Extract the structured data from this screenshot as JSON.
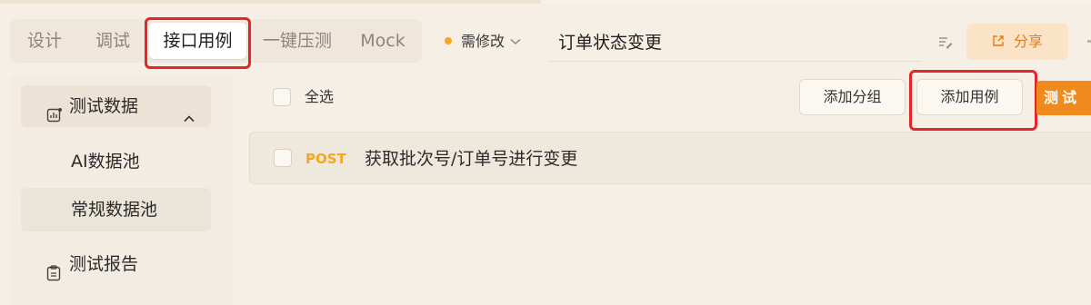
{
  "tabs": [
    {
      "label": "设计",
      "active": false
    },
    {
      "label": "调试",
      "active": false
    },
    {
      "label": "接口用例",
      "active": true
    },
    {
      "label": "一键压测",
      "active": false
    },
    {
      "label": "Mock",
      "active": false
    }
  ],
  "header": {
    "status": {
      "label": "需修改",
      "dot_color": "#f5a623",
      "icon": "chevron-down-icon"
    },
    "title_value": "订单状态变更",
    "edit_icon": "edit-icon",
    "share": {
      "label": "分享",
      "icon": "share-icon"
    }
  },
  "sidebar": {
    "section": {
      "label": "测试数据",
      "icon": "chart-icon",
      "expanded": true
    },
    "items": [
      {
        "label": "AI数据池",
        "selected": false
      },
      {
        "label": "常规数据池",
        "selected": true
      }
    ],
    "report": {
      "label": "测试报告",
      "icon": "clipboard-icon"
    }
  },
  "toolbar": {
    "select_all_label": "全选",
    "add_group_label": "添加分组",
    "add_case_label": "添加用例",
    "test_label": "测试"
  },
  "cases": [
    {
      "method": "POST",
      "name": "获取批次号/订单号进行变更"
    }
  ],
  "colors": {
    "accent": "#f08a1c",
    "method_post": "#f5a623",
    "highlight_box": "#e4252a"
  }
}
